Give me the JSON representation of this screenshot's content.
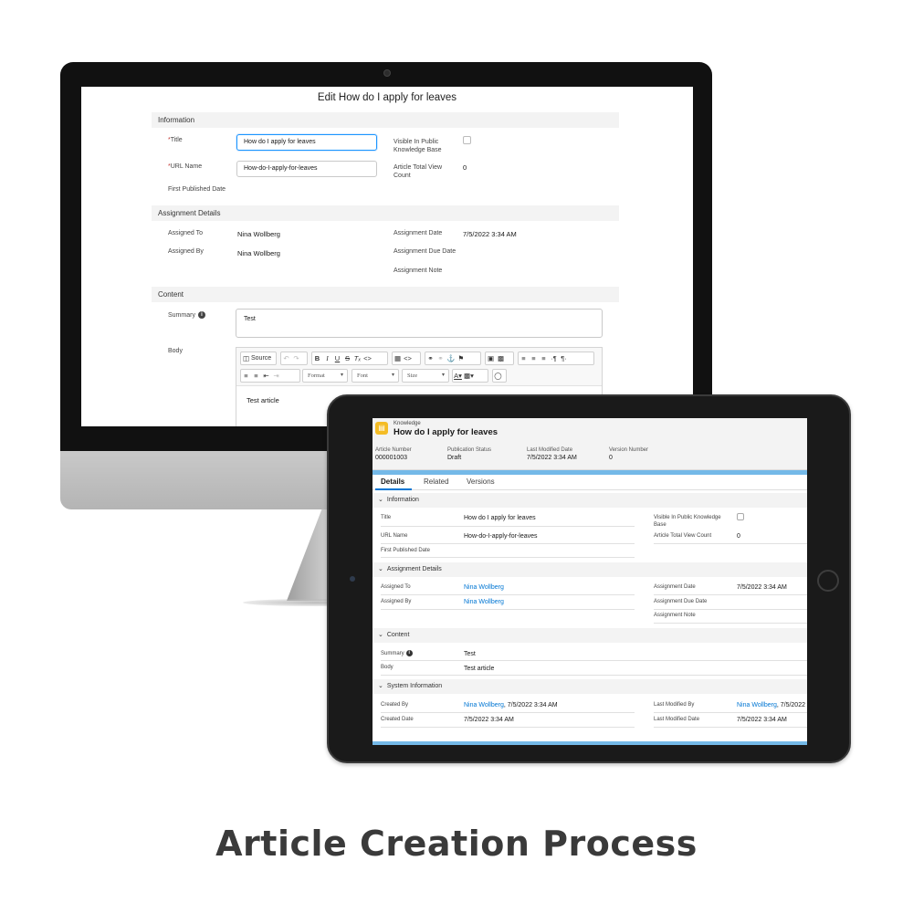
{
  "editor": {
    "title": "Edit How do I apply for leaves",
    "sections": {
      "information": "Information",
      "assignment": "Assignment Details",
      "content": "Content"
    },
    "required_mark": "*",
    "fields": {
      "title_label": "Title",
      "title_value": "How do I apply for leaves",
      "url_label": "URL Name",
      "url_value": "How-do-I-apply-for-leaves",
      "first_published_label": "First Published Date",
      "visible_label": "Visible In Public Knowledge Base",
      "view_count_label": "Article Total View Count",
      "view_count_value": "0",
      "assigned_to_label": "Assigned To",
      "assigned_to_value": "Nina Wollberg",
      "assigned_by_label": "Assigned By",
      "assigned_by_value": "Nina Wollberg",
      "assignment_date_label": "Assignment Date",
      "assignment_date_value": "7/5/2022 3:34 AM",
      "assignment_due_label": "Assignment Due Date",
      "assignment_note_label": "Assignment Note",
      "summary_label": "Summary",
      "summary_value": "Test",
      "body_label": "Body",
      "body_value": "Test article"
    },
    "toolbar": {
      "source": "Source",
      "format": "Format",
      "font": "Font",
      "size": "Size"
    }
  },
  "record": {
    "object_label": "Knowledge",
    "title": "How do I apply for leaves",
    "header_fields": [
      {
        "label": "Article Number",
        "value": "000001003"
      },
      {
        "label": "Publication Status",
        "value": "Draft"
      },
      {
        "label": "Last Modified Date",
        "value": "7/5/2022 3:34 AM"
      },
      {
        "label": "Version Number",
        "value": "0"
      }
    ],
    "tabs": [
      "Details",
      "Related",
      "Versions"
    ],
    "sections": {
      "information": "Information",
      "assignment": "Assignment Details",
      "content": "Content",
      "system": "System Information"
    },
    "info": {
      "title_label": "Title",
      "title_value": "How do I apply for leaves",
      "url_label": "URL Name",
      "url_value": "How-do-I-apply-for-leaves",
      "first_published_label": "First Published Date",
      "visible_label": "Visible In Public Knowledge Base",
      "view_count_label": "Article Total View Count",
      "view_count_value": "0"
    },
    "assignment": {
      "assigned_to_label": "Assigned To",
      "assigned_to_value": "Nina Wollberg",
      "assigned_by_label": "Assigned By",
      "assigned_by_value": "Nina Wollberg",
      "assignment_date_label": "Assignment Date",
      "assignment_date_value": "7/5/2022 3:34 AM",
      "assignment_due_label": "Assignment Due Date",
      "assignment_note_label": "Assignment Note"
    },
    "content": {
      "summary_label": "Summary",
      "summary_value": "Test",
      "body_label": "Body",
      "body_value": "Test article"
    },
    "system": {
      "created_by_label": "Created By",
      "created_by_user": "Nina Wollberg",
      "created_by_date": ", 7/5/2022 3:34 AM",
      "last_modified_by_label": "Last Modified By",
      "last_modified_by_user": "Nina Wollberg",
      "last_modified_by_date": ", 7/5/2022",
      "created_date_label": "Created Date",
      "created_date_value": "7/5/2022 3:34 AM",
      "last_modified_date_label": "Last Modified Date",
      "last_modified_date_value": "7/5/2022 3:34 AM"
    }
  },
  "caption": "Article Creation Process",
  "colors": {
    "link": "#0176d3",
    "accent_band": "#74b9e8",
    "knowledge_icon": "#f4bc25",
    "required": "#c23934"
  }
}
